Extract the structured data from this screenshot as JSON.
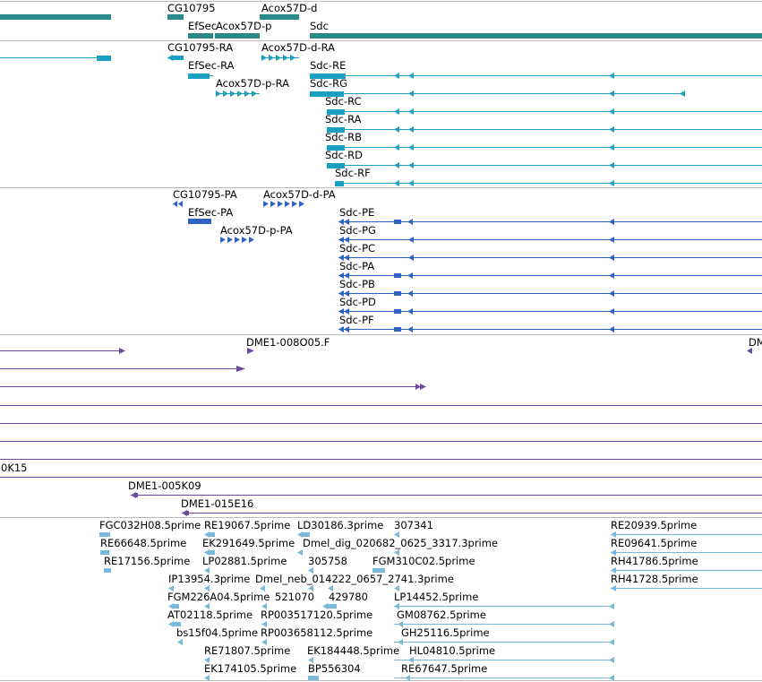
{
  "colors": {
    "gene": "#2a8a8a",
    "transcript": "#1aa0c0",
    "protein": "#2d63c6",
    "clone": "#6a4aa0",
    "est": "#7ab8dc",
    "divider": "#bcbcbc"
  },
  "tracks": {
    "genes": {
      "labels": [
        "CG10795",
        "Acox57D-d",
        "EfSec",
        "Acox57D-p",
        "Sdc"
      ]
    },
    "transcripts": {
      "labels": [
        "CG10795-RA",
        "Acox57D-d-RA",
        "EfSec-RA",
        "Sdc-RE",
        "Acox57D-p-RA",
        "Sdc-RG",
        "Sdc-RC",
        "Sdc-RA",
        "Sdc-RB",
        "Sdc-RD",
        "Sdc-RF"
      ]
    },
    "proteins": {
      "labels": [
        "CG10795-PA",
        "Acox57D-d-PA",
        "EfSec-PA",
        "Sdc-PE",
        "Acox57D-p-PA",
        "Sdc-PG",
        "Sdc-PC",
        "Sdc-PA",
        "Sdc-PB",
        "Sdc-PD",
        "Sdc-PF"
      ]
    },
    "clones": {
      "labels": [
        "DME1-008O05.F",
        "DM",
        "0K15",
        "DME1-005K09",
        "DME1-015E16"
      ]
    },
    "ests": {
      "labels": [
        "FGC032H08.5prime",
        "RE19067.5prime",
        "LD30186.3prime",
        "307341",
        "RE20939.5prime",
        "RE66648.5prime",
        "EK291649.5prime",
        "Dmel_dig_020682_0625_3317.3prime",
        "RE09641.5prime",
        "RE17156.5prime",
        "LP02881.5prime",
        "305758",
        "FGM310C02.5prime",
        "RH41786.5prime",
        "IP13954.3prime",
        "Dmel_neb_014222_0657_2741.3prime",
        "RH41728.5prime",
        "FGM226A04.5prime",
        "521070",
        "429780",
        "LP14452.5prime",
        "AT02118.5prime",
        "RP003517120.5prime",
        "GM08762.5prime",
        "bs15f04.5prime",
        "RP003658112.5prime",
        "GH25116.5prime",
        "RE71807.5prime",
        "EK184448.5prime",
        "HL04810.5prime",
        "EK174105.5prime",
        "BP556304",
        "RE67647.5prime"
      ]
    }
  }
}
